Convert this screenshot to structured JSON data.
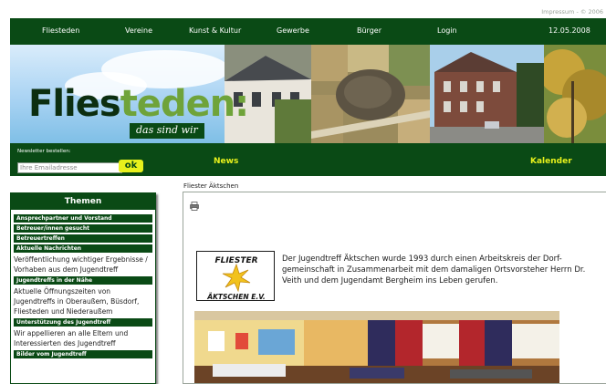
{
  "topbar": {
    "impressum": "Impressum",
    "copyright": "© 2006"
  },
  "nav": {
    "items": [
      "Fliesteden",
      "Vereine",
      "Kunst & Kultur",
      "Gewerbe",
      "Bürger",
      "Login"
    ],
    "date": "12.05.2008"
  },
  "banner": {
    "logo_dark": "Flies",
    "logo_green": "teden:",
    "tagline": "das sind wir"
  },
  "newsletter": {
    "label": "Newsletter bestellen:",
    "placeholder": "Ihre Emailadresse",
    "ok": "ok"
  },
  "links": {
    "news": "News",
    "kalender": "Kalender"
  },
  "sidebar": {
    "title": "Themen",
    "items": [
      {
        "label": "Ansprechpartner und Vorstand"
      },
      {
        "label": "Betreuer/innen gesucht"
      },
      {
        "label": "Betreuertreffen"
      },
      {
        "label": "Aktuelle Nachrichten",
        "desc": "Veröffentlichung wichtiger Ergebnisse / Vorhaben aus dem Jugendtreff"
      },
      {
        "label": "Jugendtreffs in der Nähe",
        "desc": "Aktuelle Öffnungszeiten von Jugendtreffs in Oberaußem, Büsdorf, Fliesteden und Niederaußem"
      },
      {
        "label": "Unterstützung des Jugendtreff",
        "desc": "Wir appellieren an alle Eltern und Interessierten des Jugendtreff"
      },
      {
        "label": "Bilder vom Jugendtreff"
      }
    ]
  },
  "content": {
    "breadcrumb": "Fliester Äktschen",
    "club_logo": {
      "line1": "FLIESTER",
      "line2": "ÄKTSCHEN E.V."
    },
    "article": "Der Jugendtreff Äktschen wurde 1993 durch einen Arbeitskreis der Dorf-gemeinschaft in Zusammenarbeit mit dem damaligen Ortsvorsteher Herrn Dr. Veith und dem Jugendamt Bergheim ins Leben gerufen."
  },
  "colors": {
    "green": "#0a4a15",
    "accent": "#e8f11c",
    "logo_green": "#6fa33a"
  }
}
